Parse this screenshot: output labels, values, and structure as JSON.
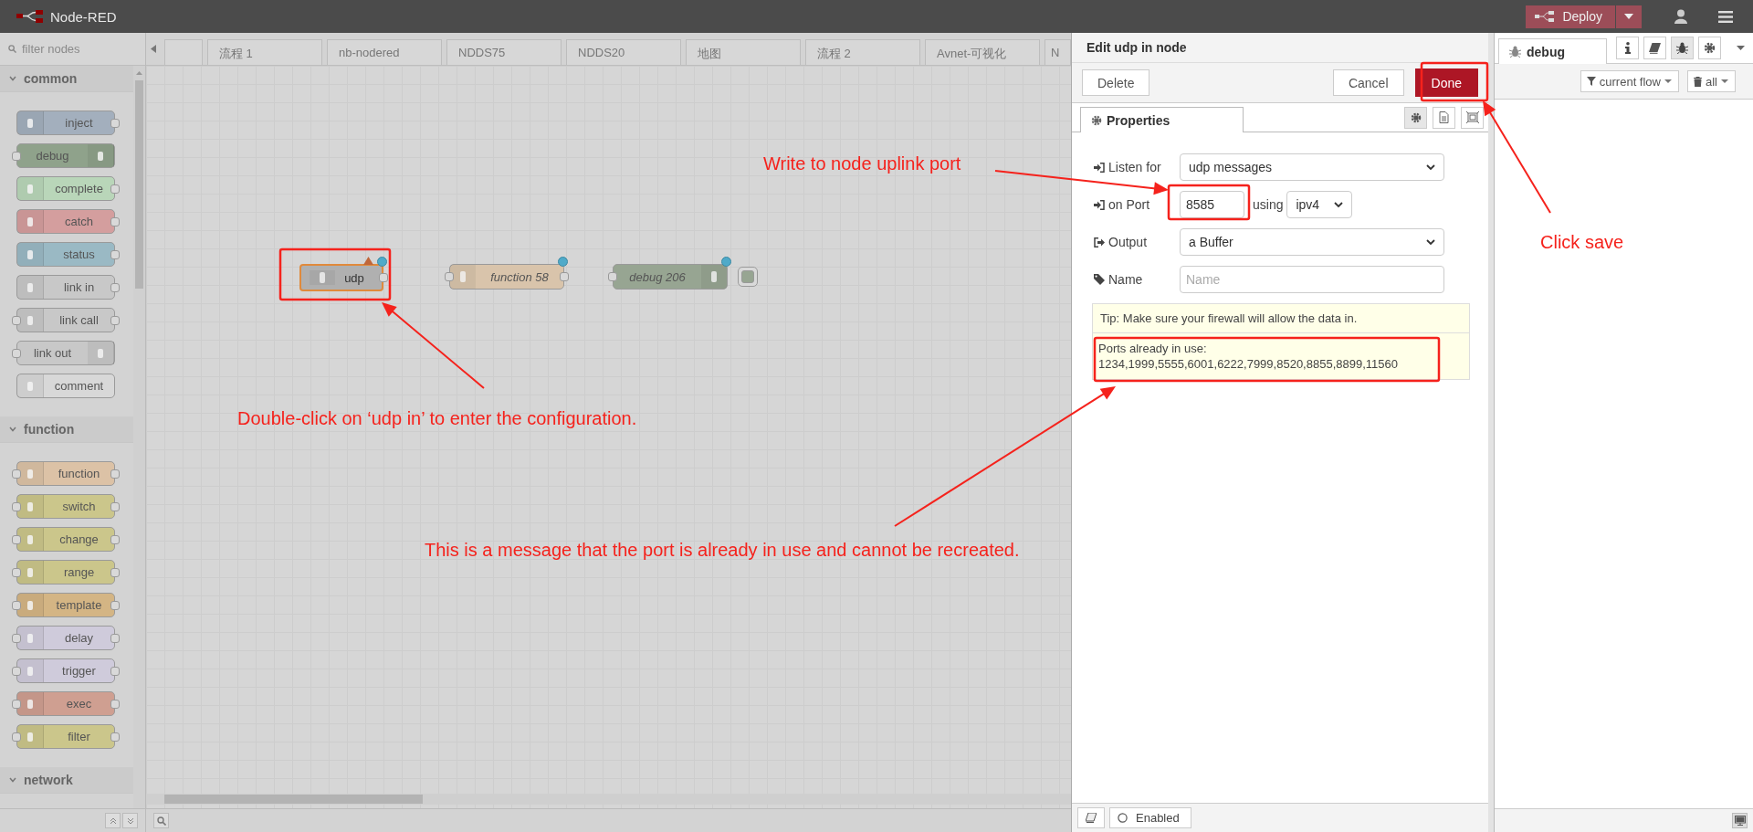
{
  "header": {
    "title": "Node-RED",
    "deploy": "Deploy"
  },
  "palette": {
    "filter_placeholder": "filter nodes",
    "categories": [
      {
        "name": "common",
        "expanded": true,
        "nodes": [
          {
            "label": "inject",
            "kind": "source",
            "color": "#a3afbd"
          },
          {
            "label": "debug",
            "kind": "sink",
            "color": "#8fa28b"
          },
          {
            "label": "complete",
            "kind": "source",
            "color": "#b9d6b9"
          },
          {
            "label": "catch",
            "kind": "source",
            "color": "#d49e9e"
          },
          {
            "label": "status",
            "kind": "source",
            "color": "#9ab9c4"
          },
          {
            "label": "link in",
            "kind": "source",
            "color": "#c8c8c8"
          },
          {
            "label": "link call",
            "kind": "through",
            "color": "#c8c8c8"
          },
          {
            "label": "link out",
            "kind": "sink",
            "color": "#c8c8c8"
          },
          {
            "label": "comment",
            "kind": "none",
            "color": "#d8d8d8"
          }
        ]
      },
      {
        "name": "function",
        "expanded": true,
        "nodes": [
          {
            "label": "function",
            "kind": "through",
            "color": "#dcc2a6"
          },
          {
            "label": "switch",
            "kind": "through",
            "color": "#cbc68b"
          },
          {
            "label": "change",
            "kind": "through",
            "color": "#cbc68b"
          },
          {
            "label": "range",
            "kind": "through",
            "color": "#cbc68b"
          },
          {
            "label": "template",
            "kind": "through",
            "color": "#d4b584"
          },
          {
            "label": "delay",
            "kind": "through",
            "color": "#cfcbdb"
          },
          {
            "label": "trigger",
            "kind": "through",
            "color": "#cfcbdb"
          },
          {
            "label": "exec",
            "kind": "through",
            "color": "#cf9f91"
          },
          {
            "label": "filter",
            "kind": "through",
            "color": "#cbc68b"
          }
        ]
      },
      {
        "name": "network",
        "expanded": true
      }
    ]
  },
  "flow_tabs": [
    "流程 1",
    "nb-nodered",
    "NDDS75",
    "NDDS20",
    "地图",
    "流程 2",
    "Avnet-可视化",
    "N"
  ],
  "canvas_nodes": [
    {
      "label": "udp",
      "kind": "source",
      "color": "#b0b0b0",
      "selected": true,
      "changed": true,
      "error": true,
      "italic": false
    },
    {
      "label": "function 58",
      "kind": "through",
      "color": "#d9c4ab",
      "selected": false,
      "changed": true,
      "error": false,
      "italic": true
    },
    {
      "label": "debug 206",
      "kind": "debug",
      "color": "#97a592",
      "selected": false,
      "changed": true,
      "error": false,
      "italic": true,
      "output_enabled": true
    }
  ],
  "editor": {
    "title": "Edit udp in node",
    "buttons": [
      {
        "label": "Delete",
        "kind": "plain"
      },
      {
        "label": "Cancel",
        "kind": "plain"
      },
      {
        "label": "Done",
        "kind": "primary"
      }
    ],
    "tabs": [
      {
        "label": "Properties",
        "selected": true
      }
    ],
    "fields": [
      {
        "label": "Listen for",
        "kind": "select",
        "value": "udp messages"
      },
      {
        "label": "on Port",
        "kind": "port",
        "value": "8585",
        "using": "using",
        "protocol": "ipv4"
      },
      {
        "label": "Output",
        "kind": "select",
        "value": "a Buffer"
      },
      {
        "label": "Name",
        "kind": "text",
        "placeholder": "Name"
      }
    ],
    "tip": "Tip: Make sure your firewall will allow the data in.",
    "ports_title": "Ports already in use:",
    "ports": "1234,1999,5555,6001,6222,7999,8520,8855,8899,11560",
    "enabled_label": "Enabled"
  },
  "sidebar": {
    "tab": "debug",
    "tools": [
      {
        "kind": "info",
        "selected": false
      },
      {
        "kind": "book",
        "selected": false
      },
      {
        "kind": "bug",
        "selected": true
      },
      {
        "kind": "gear",
        "selected": false
      }
    ],
    "filter": "current flow",
    "clear": "all"
  },
  "annotations": [
    "Write to node uplink port",
    "Click save",
    "Double-click on ‘udp in’ to enter the configuration.",
    "This is a message that the port is already in use and cannot be recreated."
  ]
}
